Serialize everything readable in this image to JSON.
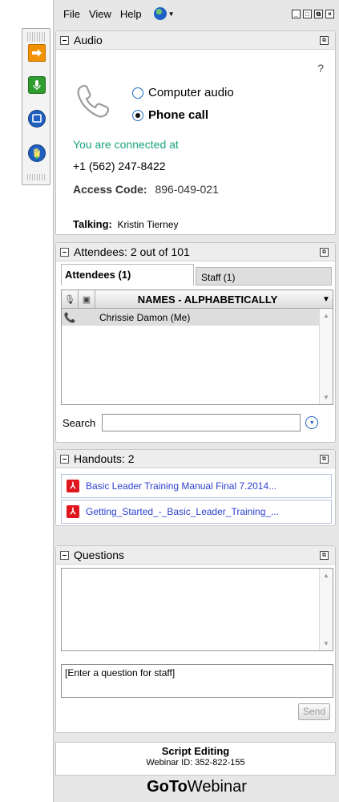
{
  "menubar": {
    "file": "File",
    "view": "View",
    "help": "Help"
  },
  "audio": {
    "title": "Audio",
    "help": "?",
    "options": {
      "computer": "Computer audio",
      "phone": "Phone call",
      "selected": "phone"
    },
    "connected_text": "You are connected at",
    "phone_number": "+1 (562) 247-8422",
    "access_label": "Access Code:",
    "access_code": "896-049-021",
    "talking_label": "Talking:",
    "talking_name": "Kristin Tierney"
  },
  "attendees": {
    "title": "Attendees:  2 out of 101",
    "tab_attendees": "Attendees (1)",
    "tab_staff": "Staff (1)",
    "column_names": "NAMES - ALPHABETICALLY",
    "rows": [
      {
        "name": "Chrissie Damon (Me)"
      }
    ],
    "search_label": "Search",
    "search_value": ""
  },
  "handouts": {
    "title": "Handouts: 2",
    "items": [
      {
        "label": "Basic Leader Training Manual Final 7.2014..."
      },
      {
        "label": "Getting_Started_-_Basic_Leader_Training_..."
      }
    ]
  },
  "questions": {
    "title": "Questions",
    "placeholder": "[Enter a question for staff]",
    "send": "Send"
  },
  "footer": {
    "title": "Script Editing",
    "webinar_id": "Webinar ID: 352-822-155",
    "brand_bold": "GoTo",
    "brand_rest": "Webinar"
  },
  "colors": {
    "accent_blue": "#1f5fbf",
    "connected_green": "#19a37f",
    "pdf_red": "#e0161e",
    "link_blue": "#2b3fcf"
  }
}
